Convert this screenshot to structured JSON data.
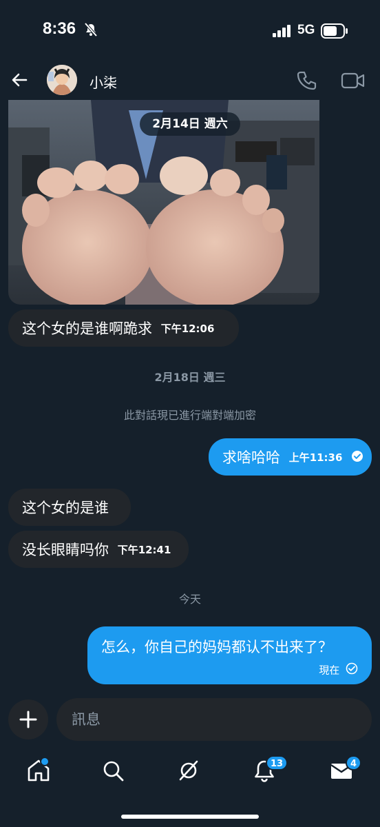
{
  "status_bar": {
    "time": "8:36",
    "network": "5G"
  },
  "header": {
    "contact_name": "小柒"
  },
  "messages": {
    "date_chip_1": "2月14日 週六",
    "m1": {
      "text": "这个女的是谁啊跪求",
      "time": "下午12:06"
    },
    "date_sep_2": "2月18日 週三",
    "encryption_notice": "此對話現已進行端對端加密",
    "m2": {
      "text": "求啥哈哈",
      "time": "上午11:36"
    },
    "m3": {
      "text": "这个女的是谁"
    },
    "m4": {
      "text": "没长眼睛吗你",
      "time": "下午12:41"
    },
    "date_sep_3": "今天",
    "m5": {
      "text": "怎么，你自己的妈妈都认不出来了？",
      "time": "現在"
    }
  },
  "composer": {
    "placeholder": "訊息"
  },
  "nav": {
    "notifications_badge": "13",
    "messages_badge": "4"
  },
  "colors": {
    "accent": "#1d9bf0",
    "background": "#15202b",
    "incoming_bubble": "#22262b"
  },
  "icons": [
    "bell-off-icon",
    "signal-icon",
    "battery-icon",
    "back-arrow-icon",
    "phone-icon",
    "video-icon",
    "plus-icon",
    "home-icon",
    "search-icon",
    "grok-icon",
    "notifications-icon",
    "mail-icon",
    "read-check-icon",
    "sent-check-icon"
  ]
}
